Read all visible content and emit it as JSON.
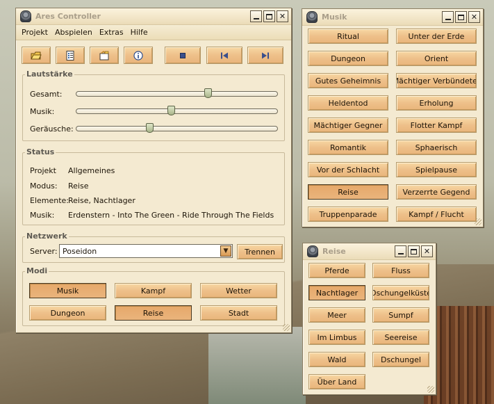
{
  "controller": {
    "title": "Ares Controller",
    "menu": [
      "Projekt",
      "Abspielen",
      "Extras",
      "Hilfe"
    ],
    "toolbar": [
      {
        "name": "open-folder-icon",
        "label": ""
      },
      {
        "name": "list-icon",
        "label": ""
      },
      {
        "name": "edit-icon",
        "label": ""
      },
      {
        "name": "info-icon",
        "label": ""
      },
      {
        "name": "stop-icon",
        "label": ""
      },
      {
        "name": "previous-icon",
        "label": ""
      },
      {
        "name": "next-icon",
        "label": ""
      }
    ],
    "volume": {
      "title": "Lautstärke",
      "sliders": [
        {
          "label": "Gesamt:",
          "value": 0.66
        },
        {
          "label": "Musik:",
          "value": 0.47
        },
        {
          "label": "Geräusche:",
          "value": 0.36
        }
      ]
    },
    "status": {
      "title": "Status",
      "rows": [
        {
          "key": "Projekt",
          "value": "Allgemeines"
        },
        {
          "key": "Modus:",
          "value": "Reise"
        },
        {
          "key": "Elemente:",
          "value": "Reise, Nachtlager"
        },
        {
          "key": "Musik:",
          "value": "Erdenstern - Into The Green - Ride Through The Fields"
        }
      ]
    },
    "network": {
      "title": "Netzwerk",
      "server_label": "Server:",
      "server_value": "Poseidon",
      "disconnect_label": "Trennen"
    },
    "modes": {
      "title": "Modi",
      "items": [
        {
          "label": "Musik",
          "active": true
        },
        {
          "label": "Kampf",
          "active": false
        },
        {
          "label": "Wetter",
          "active": false
        },
        {
          "label": "Dungeon",
          "active": false
        },
        {
          "label": "Reise",
          "active": true
        },
        {
          "label": "Stadt",
          "active": false
        }
      ]
    }
  },
  "music": {
    "title": "Musik",
    "items": [
      {
        "label": "Ritual",
        "active": false
      },
      {
        "label": "Unter der Erde",
        "active": false
      },
      {
        "label": "Dungeon",
        "active": false
      },
      {
        "label": "Orient",
        "active": false
      },
      {
        "label": "Gutes Geheimnis",
        "active": false
      },
      {
        "label": "Mächtiger Verbündeter",
        "active": false
      },
      {
        "label": "Heldentod",
        "active": false
      },
      {
        "label": "Erholung",
        "active": false
      },
      {
        "label": "Mächtiger Gegner",
        "active": false
      },
      {
        "label": "Flotter Kampf",
        "active": false
      },
      {
        "label": "Romantik",
        "active": false
      },
      {
        "label": "Sphaerisch",
        "active": false
      },
      {
        "label": "Vor der Schlacht",
        "active": false
      },
      {
        "label": "Spielpause",
        "active": false
      },
      {
        "label": "Reise",
        "active": true
      },
      {
        "label": "Verzerrte Gegend",
        "active": false
      },
      {
        "label": "Truppenparade",
        "active": false
      },
      {
        "label": "Kampf / Flucht",
        "active": false
      }
    ]
  },
  "travel": {
    "title": "Reise",
    "items": [
      {
        "label": "Pferde",
        "active": false
      },
      {
        "label": "Fluss",
        "active": false
      },
      {
        "label": "Nachtlager",
        "active": true
      },
      {
        "label": "Dschungelküste",
        "active": false
      },
      {
        "label": "Meer",
        "active": false
      },
      {
        "label": "Sumpf",
        "active": false
      },
      {
        "label": "Im Limbus",
        "active": false
      },
      {
        "label": "Seereise",
        "active": false
      },
      {
        "label": "Wald",
        "active": false
      },
      {
        "label": "Dschungel",
        "active": false
      },
      {
        "label": "Über Land",
        "active": false
      }
    ]
  },
  "window_buttons": {
    "close": "✕"
  }
}
